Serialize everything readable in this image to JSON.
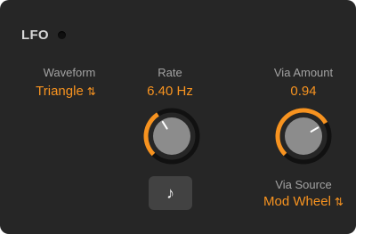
{
  "lfo": {
    "title": "LFO",
    "waveform": {
      "label": "Waveform",
      "value": "Triangle"
    },
    "rate": {
      "label": "Rate",
      "value": "6.40 Hz",
      "fraction": 0.38
    },
    "via_amount": {
      "label": "Via Amount",
      "value": "0.94",
      "fraction": 0.72
    },
    "via_source": {
      "label": "Via Source",
      "value": "Mod Wheel"
    },
    "sync_icon": "music-note-icon",
    "colors": {
      "accent": "#f79320",
      "background": "#262626",
      "knob": "#8c8c8c",
      "label": "#a3a3a3"
    }
  }
}
